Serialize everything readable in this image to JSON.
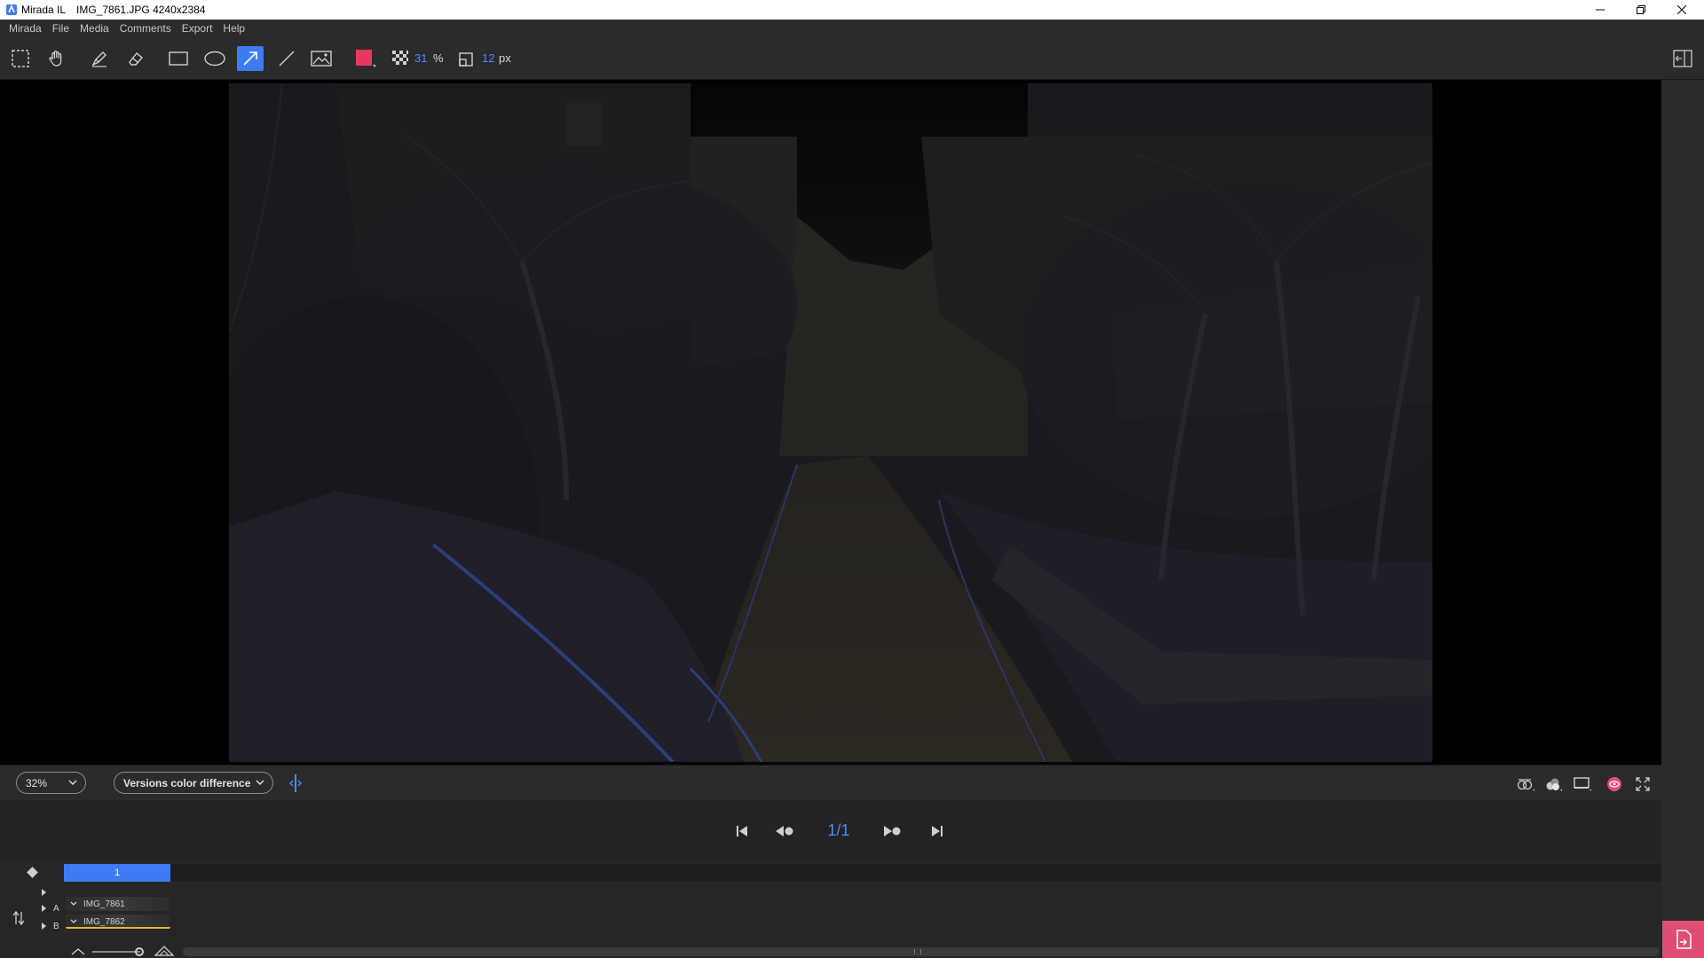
{
  "window": {
    "app_name": "Mirada IL",
    "file_title": "IMG_7861.JPG 4240x2384"
  },
  "menu": {
    "items": [
      "Mirada",
      "File",
      "Media",
      "Comments",
      "Export",
      "Help"
    ]
  },
  "toolbar": {
    "tools": [
      "select-rect",
      "hand",
      "pen",
      "eraser",
      "rectangle",
      "ellipse",
      "arrow",
      "line",
      "image"
    ],
    "active_tool": "arrow",
    "color": "#e8385f",
    "opacity_value": "31",
    "opacity_unit": "%",
    "size_value": "12",
    "size_unit": "px"
  },
  "viewbar": {
    "zoom": "32%",
    "compare_mode": "Versions color difference"
  },
  "playback": {
    "counter": "1/1"
  },
  "timeline": {
    "frame_label": "1",
    "tracks": [
      {
        "letter": "A",
        "name": "IMG_7861"
      },
      {
        "letter": "B",
        "name": "IMG_7862"
      }
    ]
  },
  "colors": {
    "accent": "#3d7cf5",
    "counter_blue": "#4a8cff",
    "export": "#e14d72",
    "annotation_color": "#e8385f"
  }
}
